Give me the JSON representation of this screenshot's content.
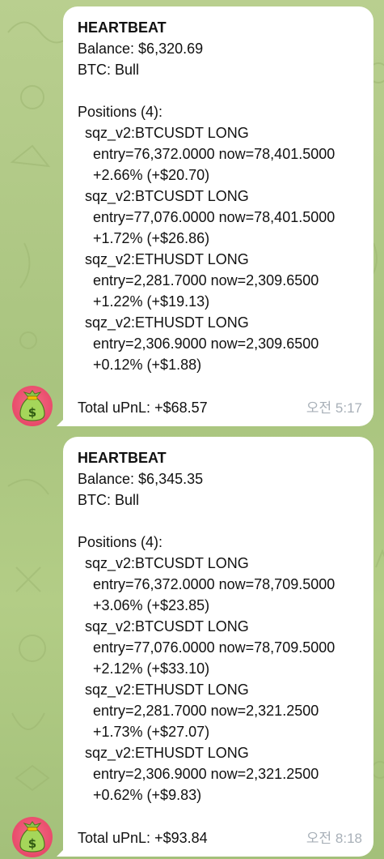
{
  "messages": [
    {
      "title": "HEARTBEAT",
      "balance": "Balance: $6,320.69",
      "btc": "BTC: Bull",
      "positions_header": "Positions (4):",
      "positions": [
        {
          "name": "sqz_v2:BTCUSDT LONG",
          "prices": "entry=76,372.0000 now=78,401.5000",
          "pnl": "+2.66% (+$20.70)"
        },
        {
          "name": "sqz_v2:BTCUSDT LONG",
          "prices": "entry=77,076.0000 now=78,401.5000",
          "pnl": "+1.72% (+$26.86)"
        },
        {
          "name": "sqz_v2:ETHUSDT LONG",
          "prices": "entry=2,281.7000 now=2,309.6500",
          "pnl": "+1.22% (+$19.13)"
        },
        {
          "name": "sqz_v2:ETHUSDT LONG",
          "prices": "entry=2,306.9000 now=2,309.6500",
          "pnl": "+0.12% (+$1.88)"
        }
      ],
      "total": "Total uPnL: +$68.57",
      "time": "오전 5:17"
    },
    {
      "title": "HEARTBEAT",
      "balance": "Balance: $6,345.35",
      "btc": "BTC: Bull",
      "positions_header": "Positions (4):",
      "positions": [
        {
          "name": "sqz_v2:BTCUSDT LONG",
          "prices": "entry=76,372.0000 now=78,709.5000",
          "pnl": "+3.06% (+$23.85)"
        },
        {
          "name": "sqz_v2:BTCUSDT LONG",
          "prices": "entry=77,076.0000 now=78,709.5000",
          "pnl": "+2.12% (+$33.10)"
        },
        {
          "name": "sqz_v2:ETHUSDT LONG",
          "prices": "entry=2,281.7000 now=2,321.2500",
          "pnl": "+1.73% (+$27.07)"
        },
        {
          "name": "sqz_v2:ETHUSDT LONG",
          "prices": "entry=2,306.9000 now=2,321.2500",
          "pnl": "+0.62% (+$9.83)"
        }
      ],
      "total": "Total uPnL: +$93.84",
      "time": "오전 8:18"
    }
  ],
  "avatar": {
    "icon": "money-bag-icon",
    "background": "#e84a6a"
  },
  "colors": {
    "chat_background": "#b3cb88",
    "bubble": "#ffffff",
    "time_text": "#a8b0b8"
  }
}
